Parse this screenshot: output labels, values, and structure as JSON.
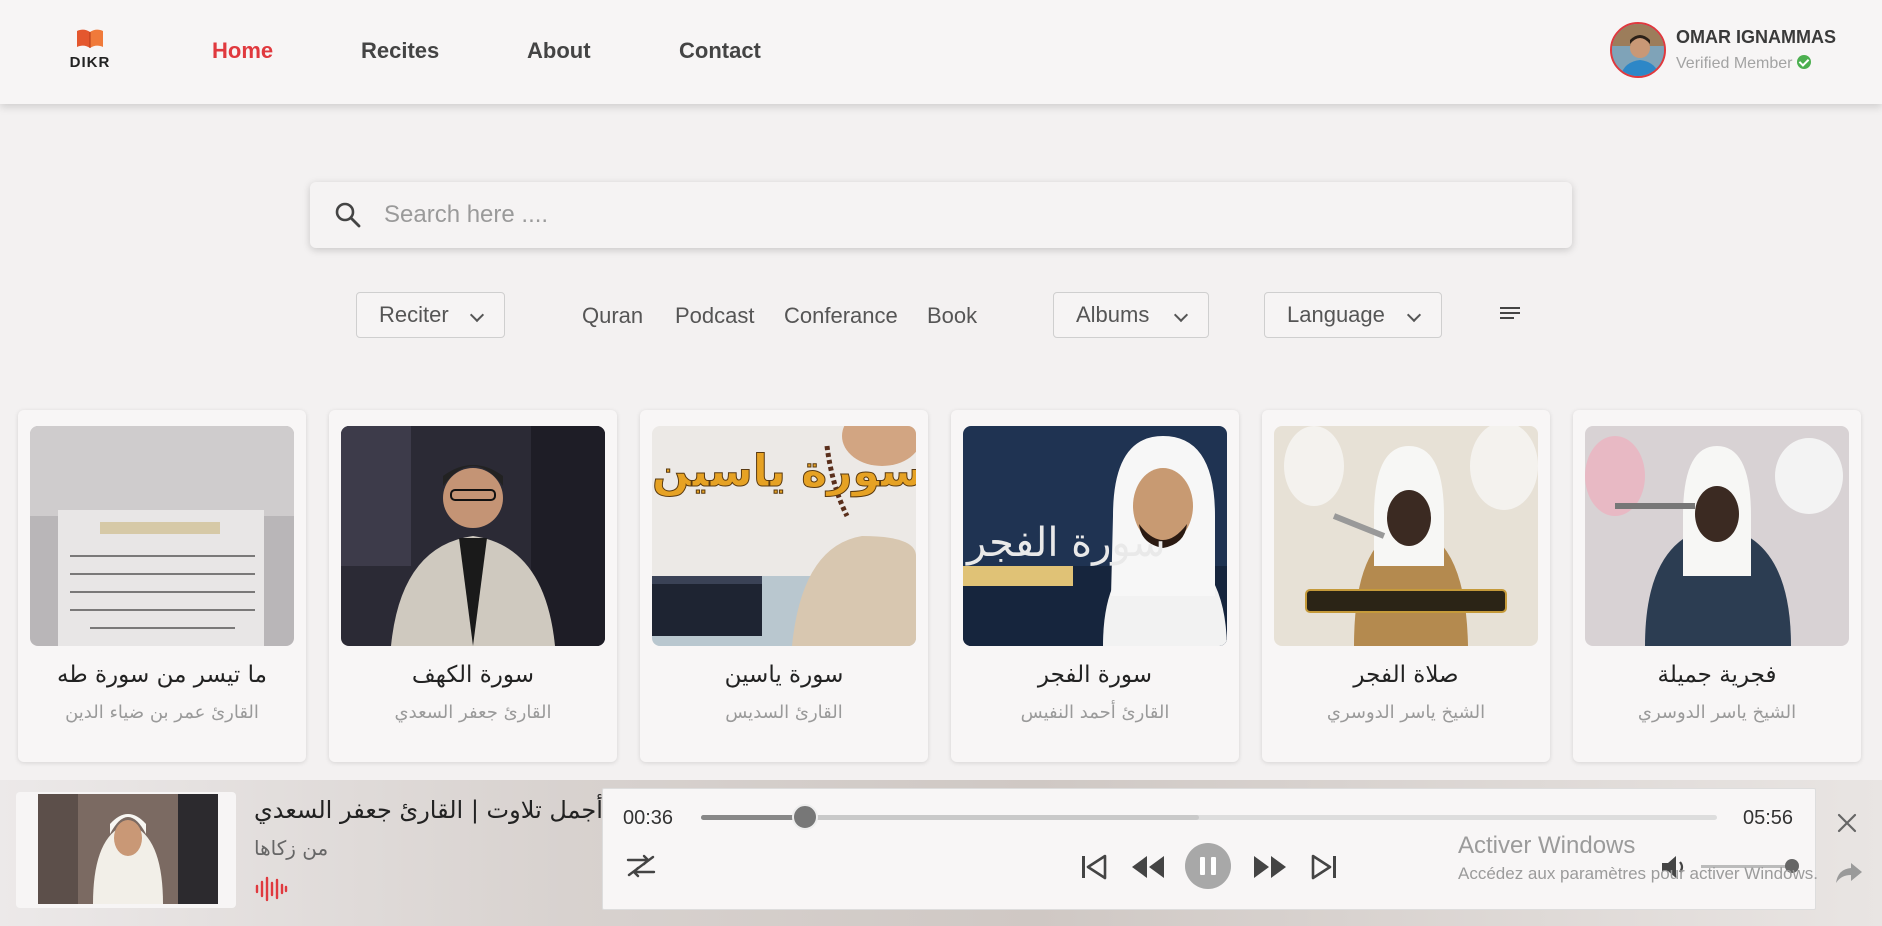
{
  "header": {
    "logo_text": "DIKR",
    "nav": [
      {
        "label": "Home",
        "active": true
      },
      {
        "label": "Recites"
      },
      {
        "label": "About"
      },
      {
        "label": "Contact"
      }
    ],
    "user": {
      "name": "OMAR IGNAMMAS",
      "status": "Verified Member"
    }
  },
  "search": {
    "placeholder": "Search here ...."
  },
  "filters": {
    "reciter": "Reciter",
    "categories": [
      "Quran",
      "Podcast",
      "Conferance",
      "Book"
    ],
    "albums": "Albums",
    "language": "Language"
  },
  "cards": [
    {
      "title": "ما تيسر من سورة طه",
      "subtitle": "القارئ عمر بن ضياء الدين"
    },
    {
      "title": "سورة الكهف",
      "subtitle": "القارئ جعفر السعدي"
    },
    {
      "title": "سورة ياسين",
      "subtitle": "القارئ السديس"
    },
    {
      "title": "سورة الفجر",
      "subtitle": "القارئ أحمد النفيس"
    },
    {
      "title": "صلاة الفجر",
      "subtitle": "الشيخ ياسر الدوسري"
    },
    {
      "title": "فجرية جميلة",
      "subtitle": "الشيخ ياسر الدوسري"
    }
  ],
  "player": {
    "title": "أجمل تلاوت | القارئ جعفر السعدي",
    "subtitle": "من زكاها",
    "current_time": "00:36",
    "duration": "05:56",
    "progress": 0.102,
    "buffered": 0.49,
    "volume": 0.95,
    "state": "playing"
  },
  "overlay": {
    "title": "Activer Windows",
    "subtitle": "Accédez aux paramètres pour activer Windows."
  },
  "colors": {
    "accent": "#e0393e",
    "verified": "#4caf50"
  }
}
